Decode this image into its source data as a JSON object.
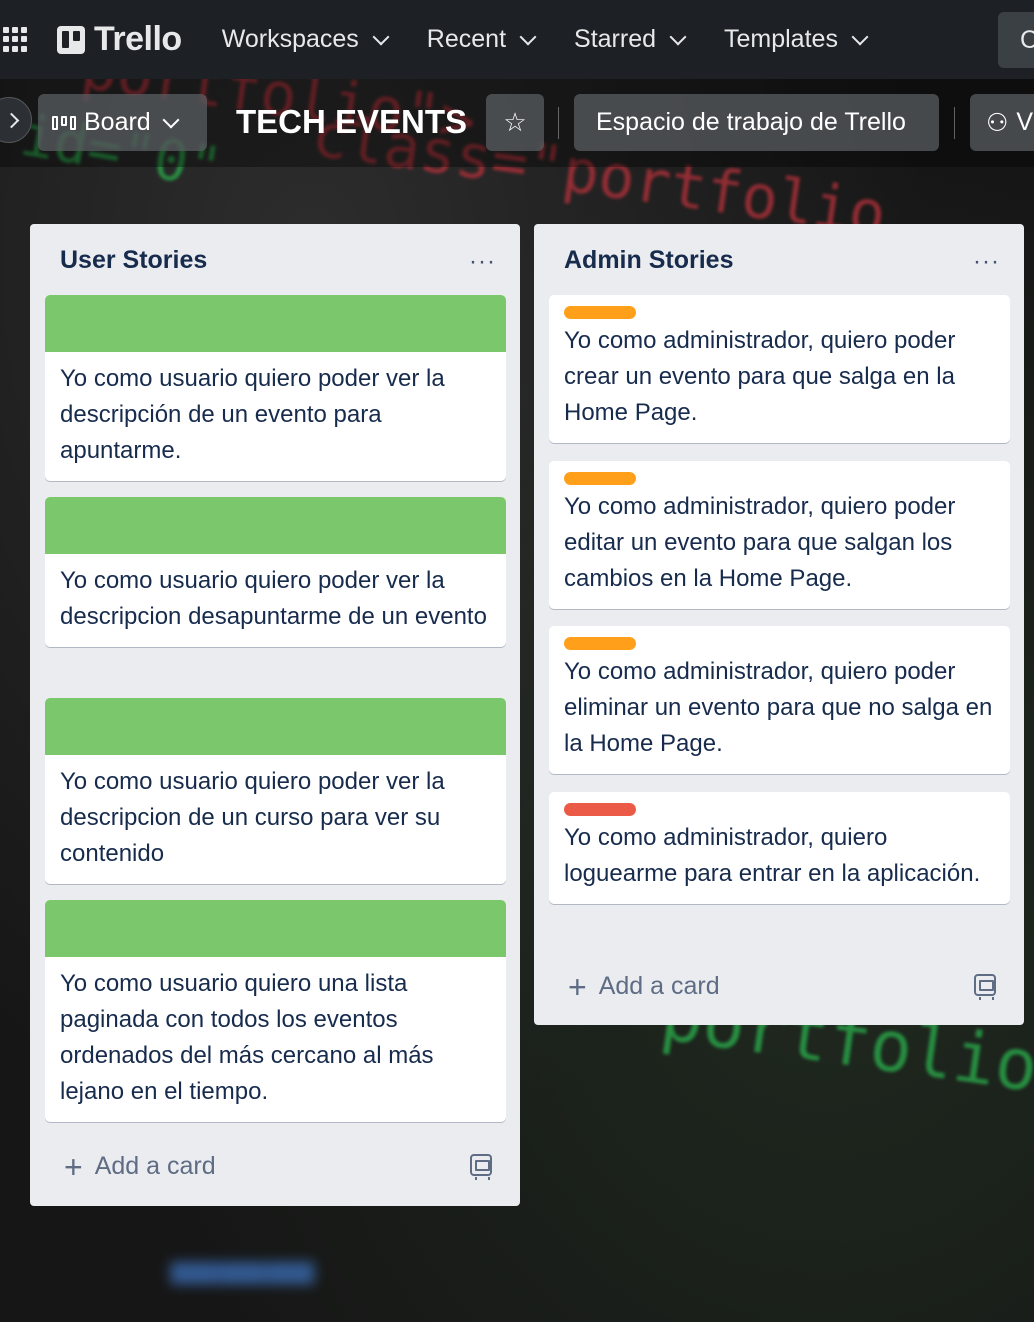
{
  "topnav": {
    "logo": "Trello",
    "menus": [
      "Workspaces",
      "Recent",
      "Starred",
      "Templates"
    ],
    "create_label": "C"
  },
  "board_header": {
    "view_label": "Board",
    "title": "TECH EVENTS",
    "workspace_label": "Espacio de trabajo de Trello",
    "visibility_label": "V"
  },
  "lists": [
    {
      "title": "User Stories",
      "menu": "···",
      "add_card": "Add a card",
      "cards": [
        {
          "cover_color": "#7bc86c",
          "text": "Yo como usuario quiero poder ver la descripción de un evento para apuntarme."
        },
        {
          "cover_color": "#7bc86c",
          "text": "Yo como usuario quiero poder ver la descripcion desapuntarme de un evento"
        },
        {
          "cover_color": "#7bc86c",
          "text": "Yo como usuario quiero poder ver la descripcion de un curso para ver su contenido"
        },
        {
          "cover_color": "#7bc86c",
          "text": "Yo como usuario quiero una lista paginada con todos los eventos ordenados del más cercano al más lejano en el tiempo."
        }
      ]
    },
    {
      "title": "Admin Stories",
      "menu": "···",
      "add_card": "Add a card",
      "cards": [
        {
          "label_color": "#ff9f1a",
          "text": "Yo como administrador, quiero poder crear un evento para que salga en la Home Page."
        },
        {
          "label_color": "#ff9f1a",
          "text": "Yo como administrador, quiero poder editar un evento para que salgan los cambios en la Home Page."
        },
        {
          "label_color": "#ff9f1a",
          "text": "Yo como administrador, quiero poder eliminar un evento para que no salga en la Home Page."
        },
        {
          "label_color": "#eb5a46",
          "text": "Yo como administrador, quiero loguearme para entrar en la aplicación."
        }
      ]
    }
  ],
  "background_code": [
    "portfolio\">",
    "id=\"0\"",
    "class=\"portfolio",
    "portfolio"
  ]
}
